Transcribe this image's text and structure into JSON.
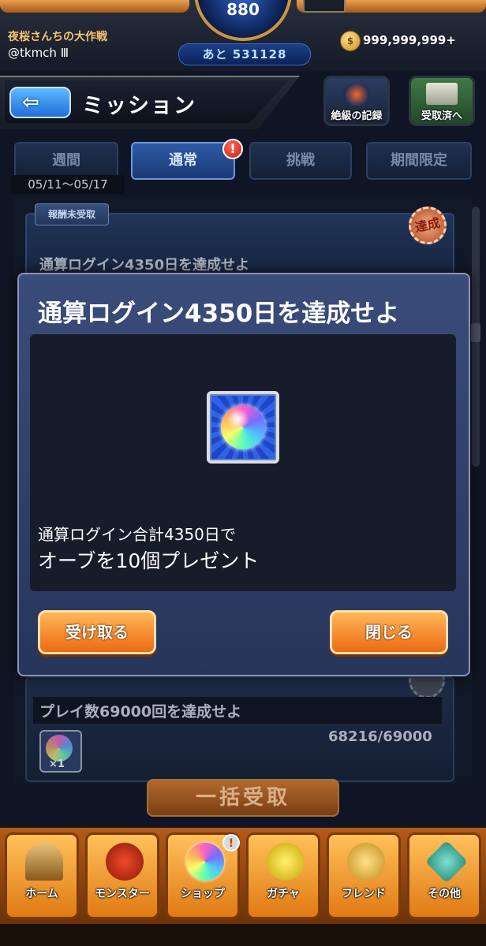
{
  "header": {
    "rank_value": "880",
    "exp_remaining": "あと 531128",
    "player_title": "夜桜さんちの大作戦",
    "player_id": "@tkmch Ⅲ",
    "coin_amount": "999,999,999+"
  },
  "title_bar": {
    "back_arrow": "⇦",
    "title": "ミッション",
    "records_label": "絶級の記録",
    "received_label": "受取済へ"
  },
  "tabs": [
    {
      "label": "週間"
    },
    {
      "label": "通常",
      "alert": "!"
    },
    {
      "label": "挑戦"
    },
    {
      "label": "期間限定"
    }
  ],
  "date_range": "05/11〜05/17",
  "missions": {
    "card1": {
      "tag": "報酬未受取",
      "stamp": "達成",
      "title": "通算ログイン4350日を達成せよ"
    },
    "card2": {
      "title": "プレイ数69000回を達成せよ",
      "reward_count": "×1",
      "progress": "68216/69000"
    },
    "claim_all_label": "一括受取"
  },
  "modal": {
    "title": "通算ログイン4350日を達成せよ",
    "reward_icon": "orb-icon",
    "line1": "通算ログイン合計4350日で",
    "line2": "オーブを10個プレゼント",
    "receive_label": "受け取る",
    "close_label": "閉じる"
  },
  "nav": [
    {
      "label": "ホーム",
      "icon": "home-icon"
    },
    {
      "label": "モンスター",
      "icon": "monster-icon"
    },
    {
      "label": "ショップ",
      "icon": "orb-icon",
      "alert": "!"
    },
    {
      "label": "ガチャ",
      "icon": "egg-icon"
    },
    {
      "label": "フレンド",
      "icon": "friends-icon"
    },
    {
      "label": "その他",
      "icon": "other-icon"
    }
  ],
  "colors": {
    "accent_orange": "#ec6a12",
    "modal_bg": "#2f3f6a",
    "tab_active": "#2e5aa4"
  }
}
